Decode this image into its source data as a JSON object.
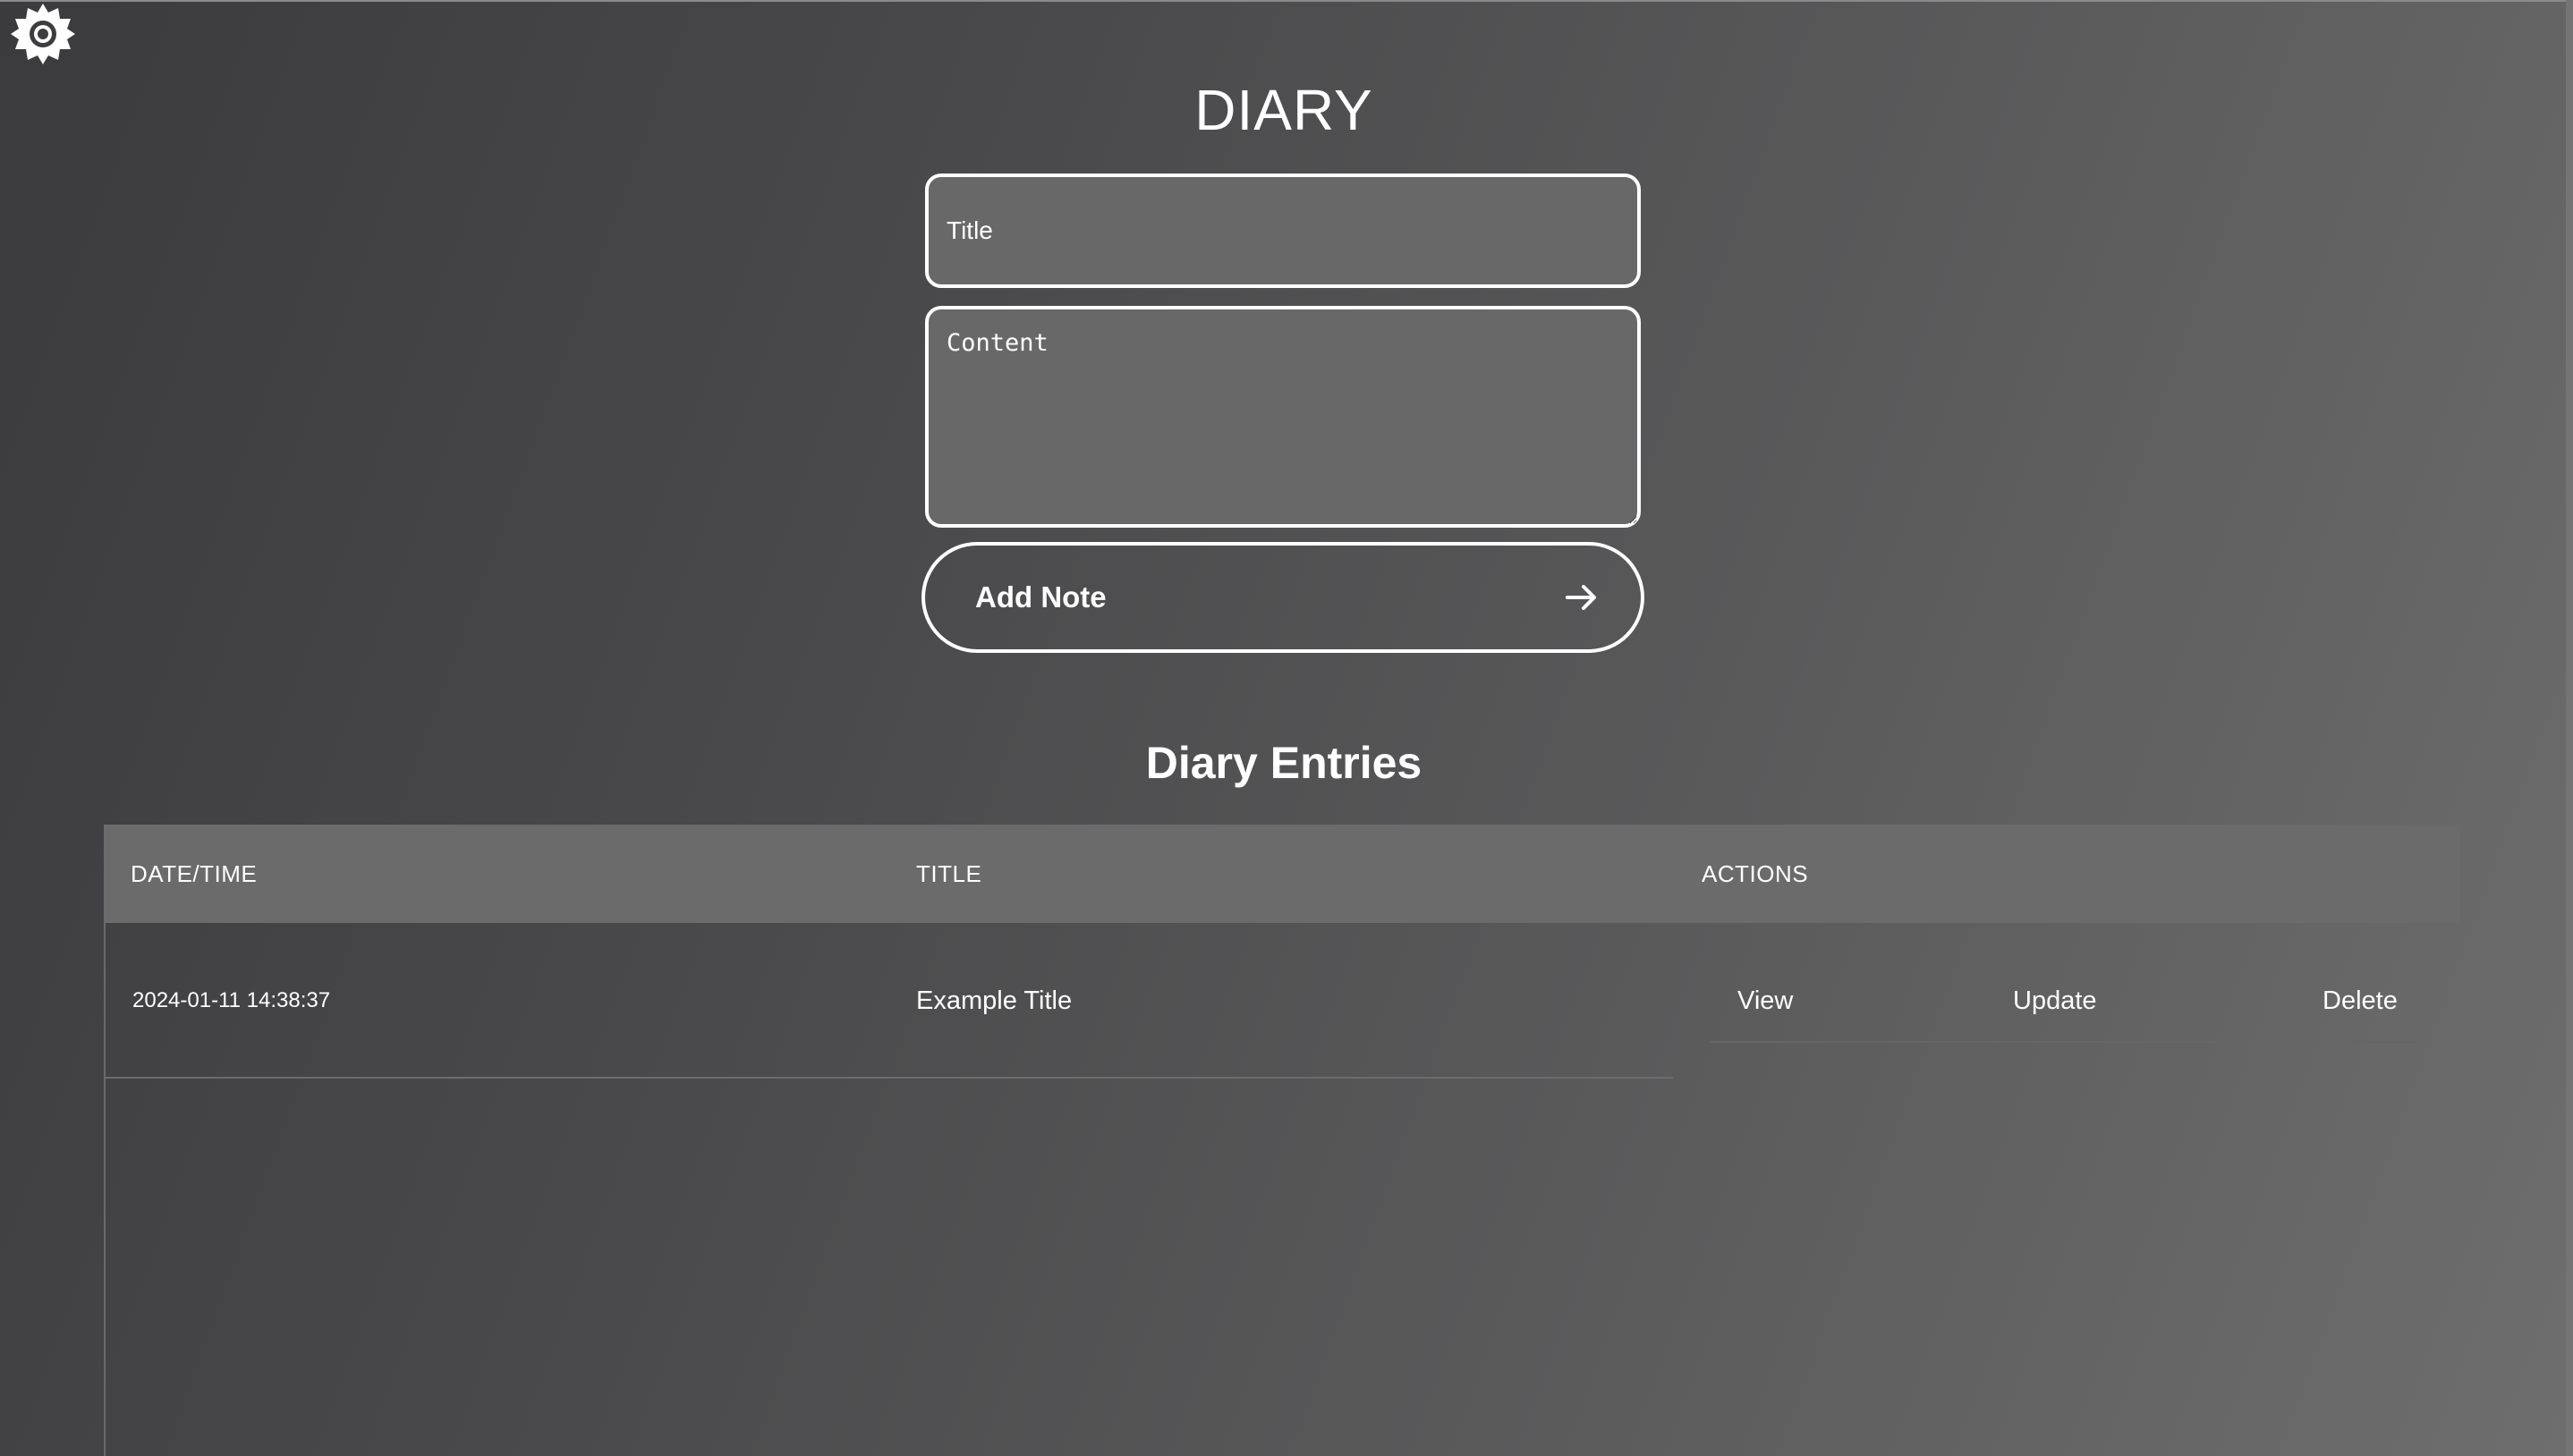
{
  "app": {
    "title": "DIARY",
    "theme_toggle_icon": "gear-icon"
  },
  "form": {
    "title_placeholder": "Title",
    "title_value": "",
    "content_placeholder": "Content",
    "content_value": "",
    "add_button_label": "Add Note",
    "add_button_icon": "arrow-right-icon"
  },
  "entries": {
    "heading": "Diary Entries",
    "columns": [
      "DATE/TIME",
      "TITLE",
      "ACTIONS"
    ],
    "rows": [
      {
        "datetime": "2024-01-11 14:38:37",
        "title": "Example Title",
        "actions": [
          "View",
          "Update",
          "Delete"
        ]
      }
    ]
  },
  "colors": {
    "text": "#ffffff",
    "input_background": "#686868",
    "header_background": "#6b6b6b"
  }
}
